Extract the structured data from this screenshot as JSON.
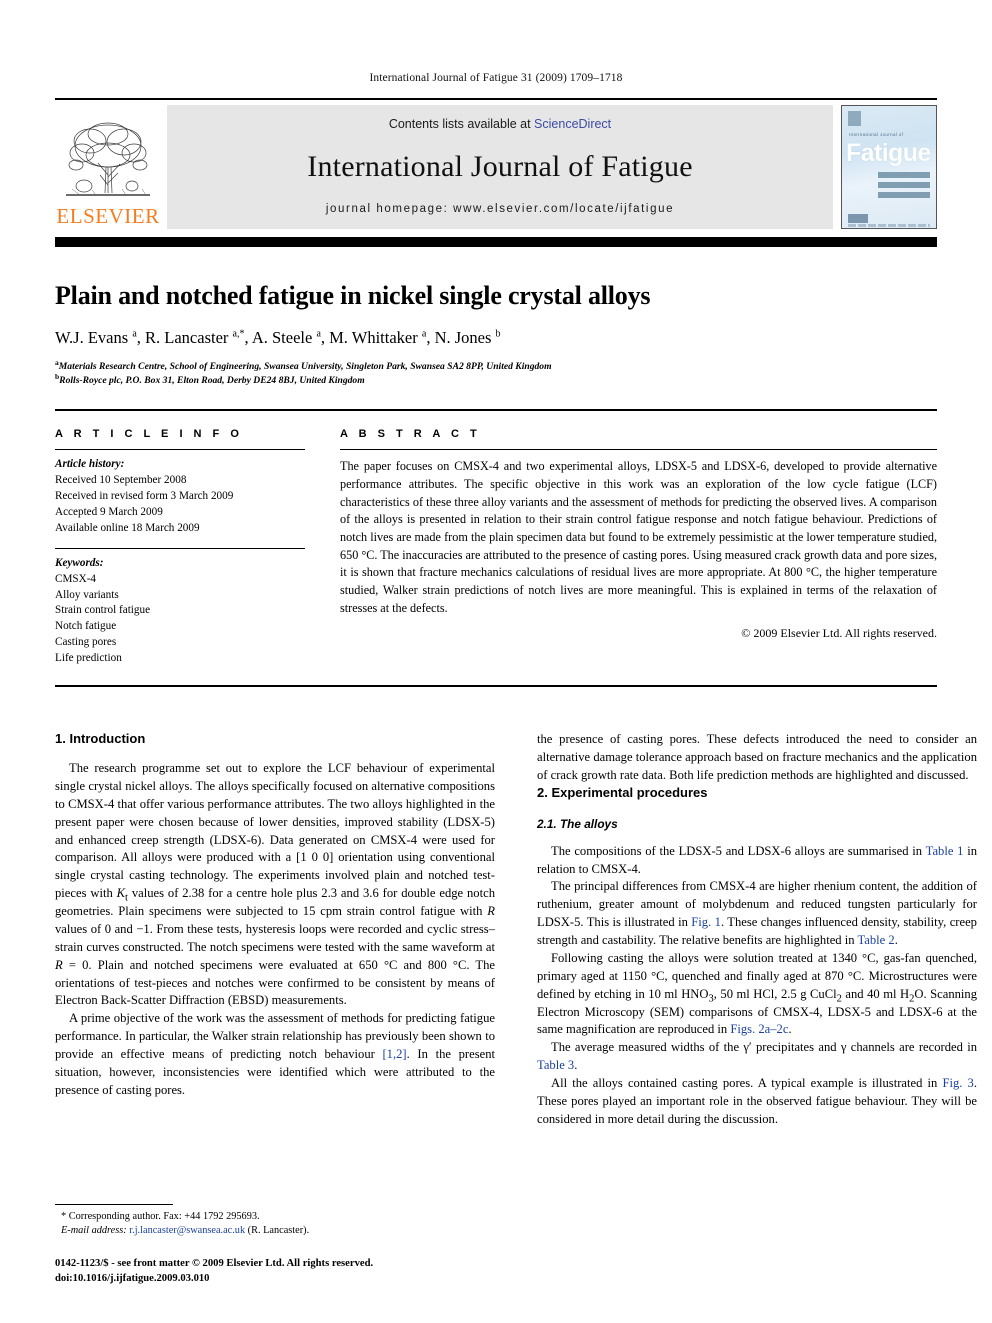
{
  "running_head": "International Journal of Fatigue 31 (2009) 1709–1718",
  "masthead": {
    "contents_prefix": "Contents lists available at ",
    "sciencedirect": "ScienceDirect",
    "journal_title": "International Journal of Fatigue",
    "homepage": "journal homepage: www.elsevier.com/locate/ijfatigue",
    "publisher_logo_text": "ELSEVIER",
    "cover": {
      "sub_title": "International Journal of",
      "title": "Fatigue",
      "accent_color": "#cfe3f2"
    },
    "link_color": "#3b4ba5",
    "logo_color": "#f47d20"
  },
  "article": {
    "title": "Plain and notched fatigue in nickel single crystal alloys",
    "authors_html": "W.J. Evans <sup>a</sup>, R. Lancaster <sup>a,*</sup>, A. Steele <sup>a</sup>, M. Whittaker <sup>a</sup>, N. Jones <sup>b</sup>",
    "affiliation_a": "Materials Research Centre, School of Engineering, Swansea University, Singleton Park, Swansea SA2 8PP, United Kingdom",
    "affiliation_b": "Rolls-Royce plc, P.O. Box 31, Elton Road, Derby DE24 8BJ, United Kingdom"
  },
  "article_info": {
    "heading": "A R T I C L E   I N F O",
    "history_label": "Article history:",
    "history": [
      "Received 10 September 2008",
      "Received in revised form 3 March 2009",
      "Accepted 9 March 2009",
      "Available online 18 March 2009"
    ],
    "keywords_label": "Keywords:",
    "keywords": [
      "CMSX-4",
      "Alloy variants",
      "Strain control fatigue",
      "Notch fatigue",
      "Casting pores",
      "Life prediction"
    ]
  },
  "abstract": {
    "heading": "A B S T R A C T",
    "text": "The paper focuses on CMSX-4 and two experimental alloys, LDSX-5 and LDSX-6, developed to provide alternative performance attributes. The specific objective in this work was an exploration of the low cycle fatigue (LCF) characteristics of these three alloy variants and the assessment of methods for predicting the observed lives. A comparison of the alloys is presented in relation to their strain control fatigue response and notch fatigue behaviour. Predictions of notch lives are made from the plain specimen data but found to be extremely pessimistic at the lower temperature studied, 650 °C. The inaccuracies are attributed to the presence of casting pores. Using measured crack growth data and pore sizes, it is shown that fracture mechanics calculations of residual lives are more appropriate. At 800 °C, the higher temperature studied, Walker strain predictions of notch lives are more meaningful. This is explained in terms of the relaxation of stresses at the defects.",
    "copyright": "© 2009 Elsevier Ltd. All rights reserved."
  },
  "sections": {
    "intro_heading": "1. Introduction",
    "intro_p1": "The research programme set out to explore the LCF behaviour of experimental single crystal nickel alloys. The alloys specifically focused on alternative compositions to CMSX-4 that offer various performance attributes. The two alloys highlighted in the present paper were chosen because of lower densities, improved stability (LDSX-5) and enhanced creep strength (LDSX-6). Data generated on CMSX-4 were used for comparison. All alloys were produced with a [1 0 0] orientation using conventional single crystal casting technology. The experiments involved plain and notched test-pieces with Kt values of 2.38 for a centre hole plus 2.3 and 3.6 for double edge notch geometries. Plain specimens were subjected to 15 cpm strain control fatigue with R values of 0 and −1. From these tests, hysteresis loops were recorded and cyclic stress–strain curves constructed. The notch specimens were tested with the same waveform at R = 0. Plain and notched specimens were evaluated at 650 °C and 800 °C. The orientations of test-pieces and notches were confirmed to be consistent by means of Electron Back-Scatter Diffraction (EBSD) measurements.",
    "intro_p2_a": "A prime objective of the work was the assessment of methods for predicting fatigue performance. In particular, the Walker strain relationship has previously been shown to provide an effective means of predicting notch behaviour ",
    "intro_p2_ref": "[1,2]",
    "intro_p2_b": ". In the present situation, however, inconsistencies were identified which were attributed to the presence of casting pores. These defects introduced the need to consider an alternative damage tolerance approach based on fracture mechanics and the application of crack growth rate data. Both life prediction methods are highlighted and discussed.",
    "exp_heading": "2. Experimental procedures",
    "alloys_heading": "2.1. The alloys",
    "alloys_p1_a": "The compositions of the LDSX-5 and LDSX-6 alloys are summarised in ",
    "alloys_p1_ref": "Table 1",
    "alloys_p1_b": " in relation to CMSX-4.",
    "alloys_p2_a": "The principal differences from CMSX-4 are higher rhenium content, the addition of ruthenium, greater amount of molybdenum and reduced tungsten particularly for LDSX-5. This is illustrated in ",
    "alloys_p2_ref1": "Fig. 1",
    "alloys_p2_b": ". These changes influenced density, stability, creep strength and castability. The relative benefits are highlighted in ",
    "alloys_p2_ref2": "Table 2",
    "alloys_p2_c": ".",
    "alloys_p3_a": "Following casting the alloys were solution treated at 1340 °C, gas-fan quenched, primary aged at 1150 °C, quenched and finally aged at 870 °C. Microstructures were defined by etching in 10 ml HNO",
    "alloys_p3_b": ", 50 ml HCl, 2.5 g CuCl",
    "alloys_p3_c": " and 40 ml H",
    "alloys_p3_d": "O. Scanning Electron Microscopy (SEM) comparisons of CMSX-4, LDSX-5 and LDSX-6 at the same magnification are reproduced in ",
    "alloys_p3_ref": "Figs. 2a–2c",
    "alloys_p3_e": ".",
    "alloys_p4_a": "The average measured widths of the γ′ precipitates and γ channels are recorded in ",
    "alloys_p4_ref": "Table 3",
    "alloys_p4_b": ".",
    "alloys_p5_a": "All the alloys contained casting pores. A typical example is illustrated in ",
    "alloys_p5_ref": "Fig. 3",
    "alloys_p5_b": ". These pores played an important role in the observed fatigue behaviour. They will be considered in more detail during the discussion."
  },
  "footnote": {
    "corresponding": "* Corresponding author. Fax: +44 1792 295693.",
    "email_label": "E-mail address:",
    "email": "r.j.lancaster@swansea.ac.uk",
    "email_suffix": " (R. Lancaster).",
    "issn_line": "0142-1123/$ - see front matter © 2009 Elsevier Ltd. All rights reserved.",
    "doi_line": "doi:10.1016/j.ijfatigue.2009.03.010"
  }
}
